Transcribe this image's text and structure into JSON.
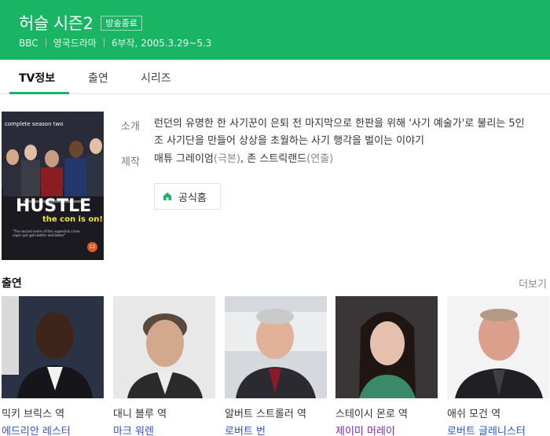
{
  "header": {
    "title": "허슬 시즌2",
    "badge": "방송종료",
    "channel": "BBC",
    "genre": "영국드라마",
    "episodes_dates": "6부작, 2005.3.29~5.3",
    "bg_color": "#19b564"
  },
  "tabs": [
    {
      "label": "TV정보",
      "active": true
    },
    {
      "label": "출연",
      "active": false
    },
    {
      "label": "시리즈",
      "active": false
    }
  ],
  "poster": {
    "top_text": "complete season two",
    "title": "HUSTLE",
    "tagline": "the con is on!",
    "fine_print": "\"The second series of this superslick crime caper just gets better and better\"",
    "rating": "12"
  },
  "info": {
    "intro_label": "소개",
    "intro_text": "런던의 유명한 한 사기꾼이 은퇴 전 마지막으로 한판을 위해 '사기 예술가'로 불리는 5인조 사기단을 만들어 상상을 초월하는 사기 행각을 벌이는 이야기",
    "production_label": "제작",
    "producer1": "매튜 그레이엄",
    "producer1_role": "(극본)",
    "producer2": "존 스트릭랜드",
    "producer2_role": "(연출)",
    "homepage_label": "공식홈",
    "homepage_icon": "home-icon"
  },
  "cast": {
    "title": "출연",
    "more_label": "더보기",
    "members": [
      {
        "role": "믹키 브릭스 역",
        "actor": "에드리안 레스터"
      },
      {
        "role": "대니 블루 역",
        "actor": "마크 워렌"
      },
      {
        "role": "알버트 스트롤러 역",
        "actor": "로버트 번"
      },
      {
        "role": "스테이시 몬로 역",
        "actor": "제이미 머레이"
      },
      {
        "role": "애쉬 모건 역",
        "actor": "로버트 글레니스터"
      }
    ]
  }
}
